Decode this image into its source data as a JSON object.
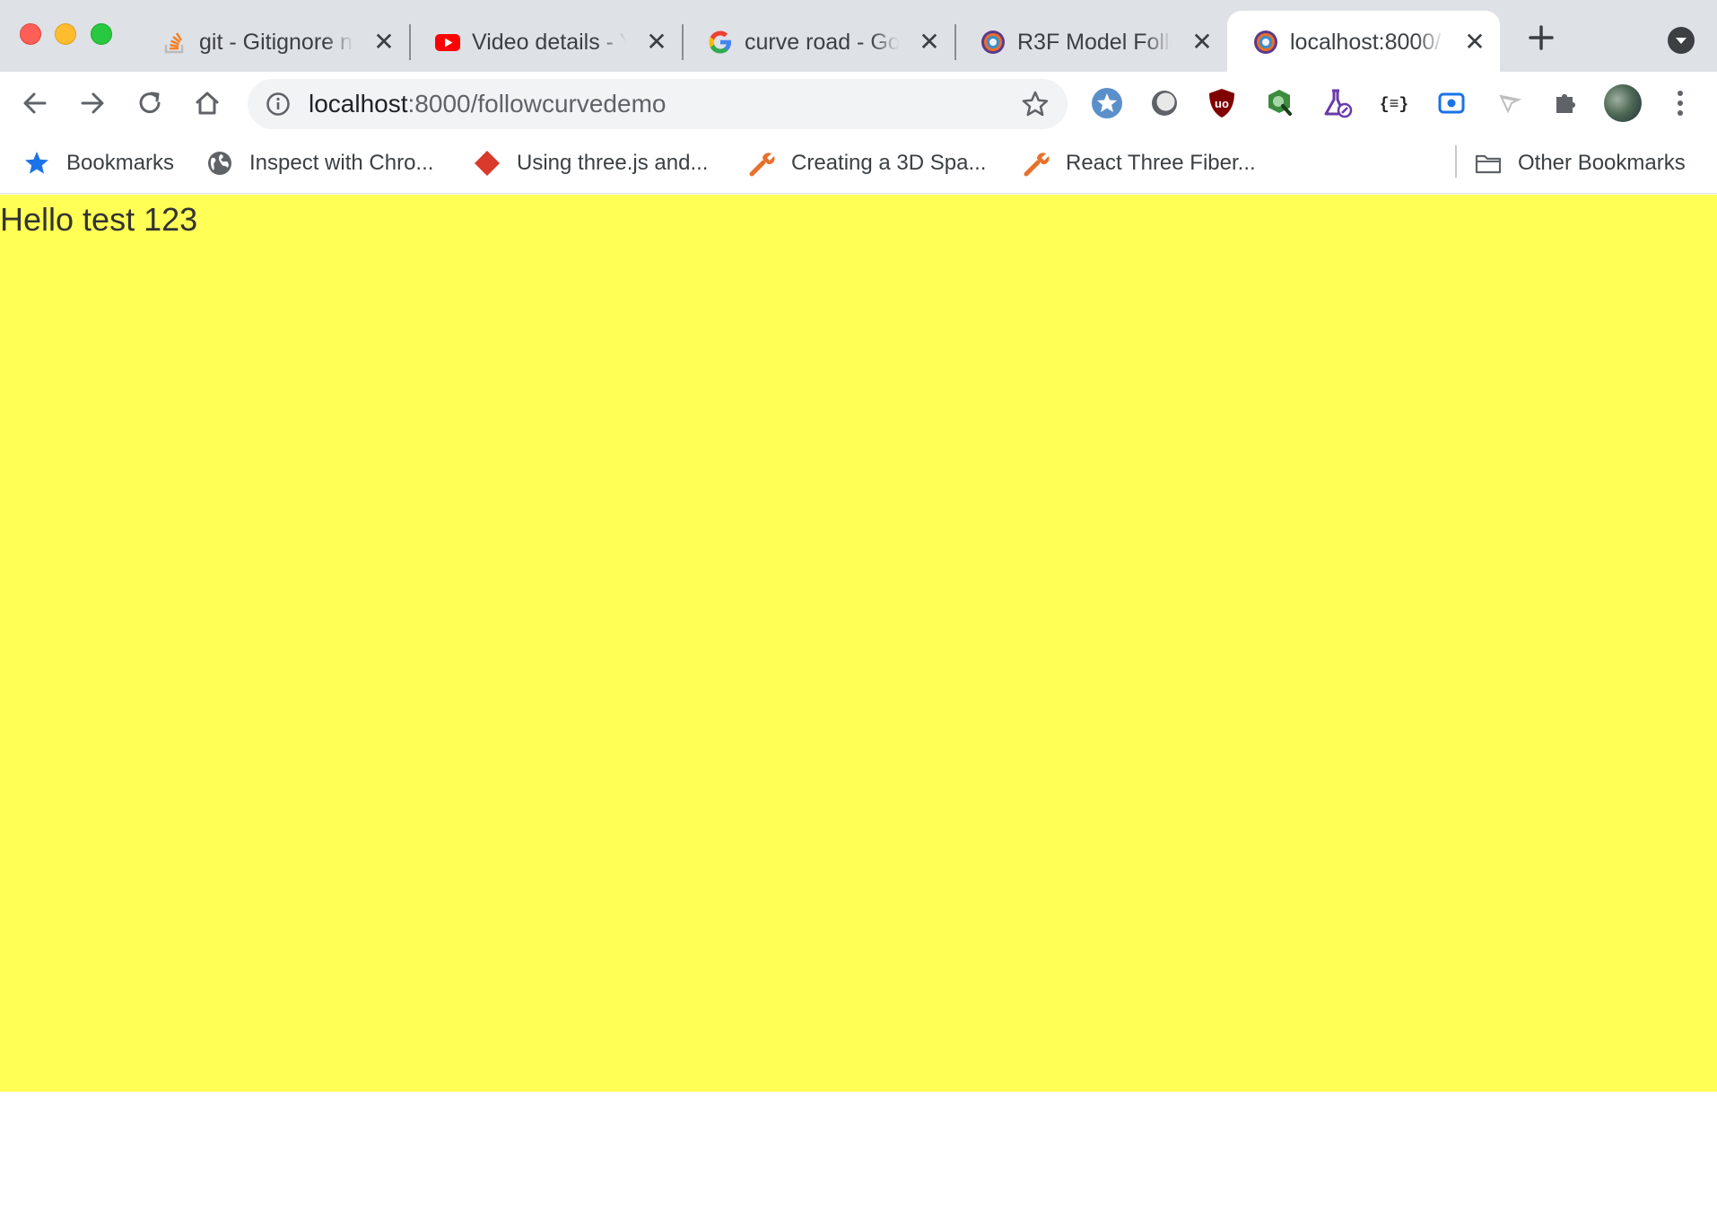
{
  "tabs": [
    {
      "title": "git - Gitignore n",
      "favicon": "stackoverflow-icon",
      "active": false
    },
    {
      "title": "Video details - Y",
      "favicon": "youtube-icon",
      "active": false
    },
    {
      "title": "curve road - Go",
      "favicon": "google-icon",
      "active": false
    },
    {
      "title": "R3F Model Follo",
      "favicon": "r3f-icon",
      "active": false
    },
    {
      "title": "localhost:8000/",
      "favicon": "r3f-icon",
      "active": true
    }
  ],
  "toolbar": {
    "url_host": "localhost",
    "url_rest": ":8000/followcurvedemo"
  },
  "extensions": [
    "bookmark-star-icon",
    "circle-ext-icon",
    "ublock-icon",
    "search-ext-icon",
    "flask-icon",
    "json-formatter-icon",
    "screencast-icon",
    "cursor-ext-icon",
    "puzzle-icon"
  ],
  "bookmarks": {
    "items": [
      {
        "label": "Bookmarks",
        "icon": "star-icon"
      },
      {
        "label": "Inspect with Chro...",
        "icon": "globe-icon"
      },
      {
        "label": "Using three.js and...",
        "icon": "diamond-icon"
      },
      {
        "label": "Creating a 3D Spa...",
        "icon": "wrench-icon"
      },
      {
        "label": "React Three Fiber...",
        "icon": "wrench-icon"
      }
    ],
    "other": "Other Bookmarks"
  },
  "content": {
    "text": "Hello test 123",
    "background": "#ffff55"
  }
}
